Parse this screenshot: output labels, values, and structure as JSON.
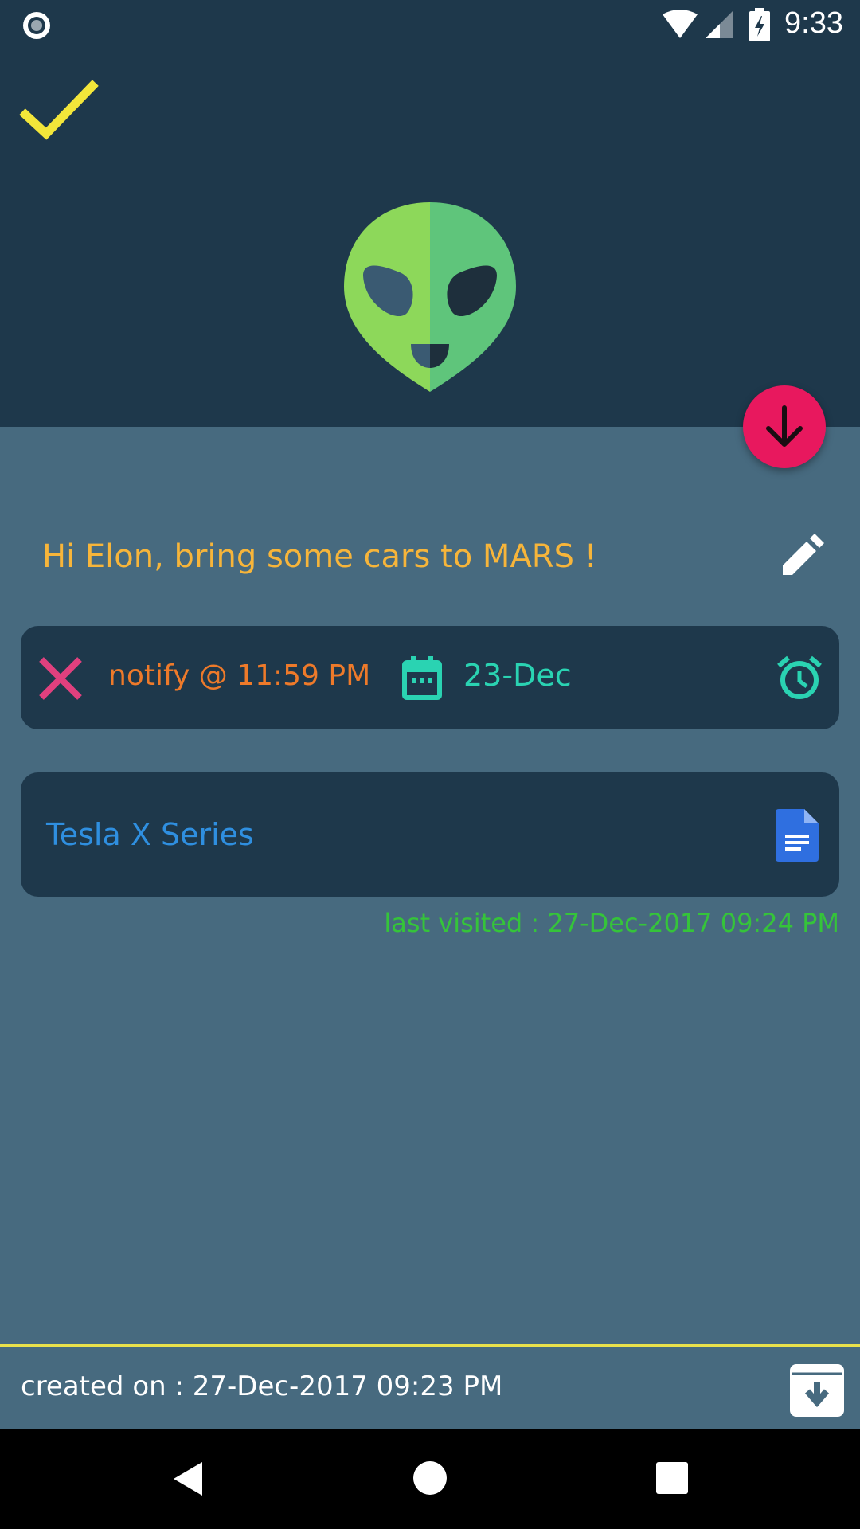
{
  "status_bar": {
    "time": "9:33"
  },
  "note": {
    "title": "Hi Elon, bring some cars to MARS !"
  },
  "reminder": {
    "notify_text": "notify @ 11:59 PM",
    "date_text": "23-Dec"
  },
  "attachment": {
    "name": "Tesla  X Series",
    "last_visited": "last visited : 27-Dec-2017 09:24 PM"
  },
  "footer": {
    "created_on": "created on : 27-Dec-2017 09:23 PM"
  },
  "colors": {
    "header_bg": "#1e384b",
    "body_bg": "#476a7f",
    "check_yellow": "#f3e63a",
    "title_orange": "#f7b53a",
    "notify_orange": "#ee7a2a",
    "teal": "#2ad3b2",
    "fab_pink": "#e8185e",
    "link_blue": "#2f8fe0",
    "green_text": "#35c43a"
  },
  "icons": [
    "record-icon",
    "wifi-icon",
    "signal-icon",
    "battery-charging-icon",
    "check-icon",
    "alien-avatar-icon",
    "arrow-down-icon",
    "edit-pencil-icon",
    "close-x-icon",
    "calendar-icon",
    "alarm-clock-icon",
    "google-docs-icon",
    "archive-icon",
    "back-icon",
    "home-icon",
    "recents-icon"
  ]
}
